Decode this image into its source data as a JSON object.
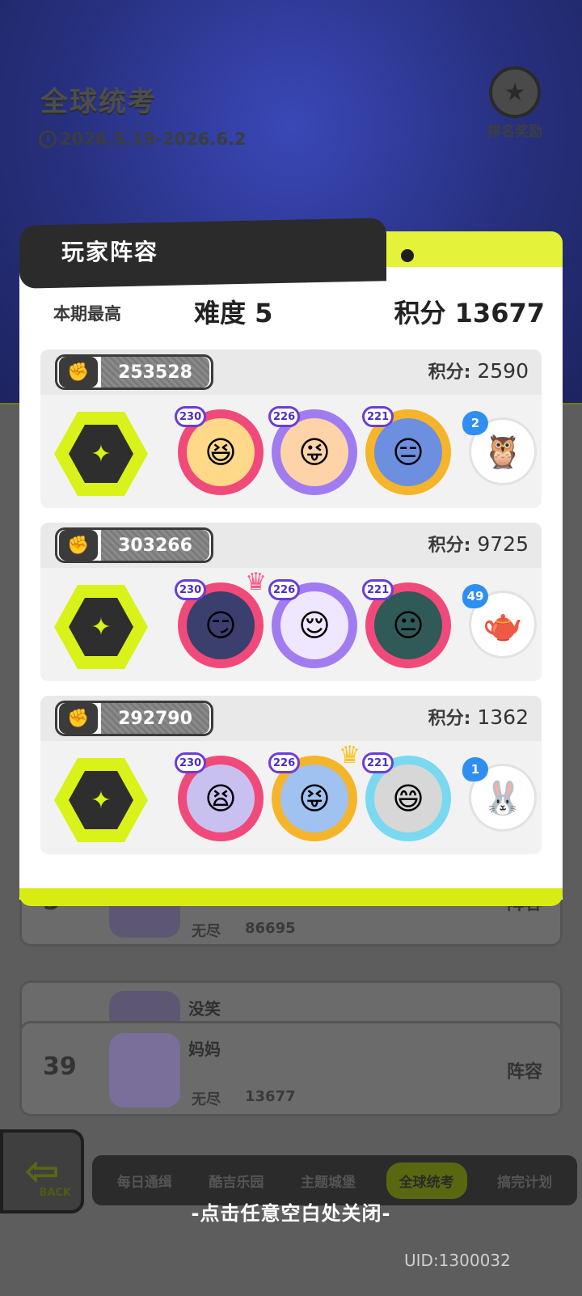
{
  "event": {
    "title": "全球统考",
    "date_range": "2026.5.19-2026.6.2",
    "reward_label": "排名奖励"
  },
  "modal": {
    "title": "玩家阵容",
    "summary_label": "本期最高",
    "difficulty": "难度 5",
    "score": "积分 13677",
    "points_key": "积分:",
    "teams": [
      {
        "id": "253528",
        "points": "2590",
        "heroes": [
          {
            "level": "230",
            "icon": "blonde-heroine-portrait",
            "frame": "#f04a7a",
            "face": "#ffd889",
            "glyph": "😆"
          },
          {
            "level": "226",
            "icon": "orange-hair-heroine-portrait",
            "frame": "#a07cf0",
            "face": "#ffd3a8",
            "glyph": "😜"
          },
          {
            "level": "221",
            "icon": "blue-hair-heroine-portrait",
            "frame": "#f5b52a",
            "face": "#6d8fe0",
            "glyph": "😑"
          }
        ],
        "pet": {
          "level": "2",
          "icon": "yellow-owl-pet",
          "glyph": "🦉"
        }
      },
      {
        "id": "303266",
        "points": "9725",
        "heroes": [
          {
            "level": "230",
            "icon": "dark-hair-heroine-portrait",
            "frame": "#f04a7a",
            "face": "#3a3f6e",
            "glyph": "😏",
            "crown": true,
            "crown_color": "#ff5a86"
          },
          {
            "level": "226",
            "icon": "lavender-sheep-heroine-portrait",
            "frame": "#a07cf0",
            "face": "#efe6ff",
            "glyph": "😌"
          },
          {
            "level": "221",
            "icon": "green-hair-heroine-portrait",
            "frame": "#f04a7a",
            "face": "#2f5a58",
            "glyph": "😐"
          }
        ],
        "pet": {
          "level": "49",
          "icon": "blue-teapot-pet",
          "glyph": "🫖"
        }
      },
      {
        "id": "292790",
        "points": "1362",
        "heroes": [
          {
            "level": "230",
            "icon": "silver-hair-heroine-portrait",
            "frame": "#f04a7a",
            "face": "#c8c1f0",
            "glyph": "😫"
          },
          {
            "level": "226",
            "icon": "blue-hair-crowned-heroine-portrait",
            "frame": "#f5b52a",
            "face": "#9fc2f0",
            "glyph": "😝",
            "crown": true,
            "crown_color": "#ffc21a"
          },
          {
            "level": "221",
            "icon": "gray-hair-heroine-portrait",
            "frame": "#7ad8f0",
            "face": "#d7d7d7",
            "glyph": "😄"
          }
        ],
        "pet": {
          "level": "1",
          "icon": "blue-bunny-pet",
          "glyph": "🐰"
        }
      }
    ]
  },
  "background_rows": [
    {
      "rank": "5",
      "name": "",
      "mode": "无尽",
      "score": "86695",
      "lineup": "阵容"
    },
    {
      "rank": "",
      "name": "没笑",
      "mode": "",
      "score": "",
      "lineup": ""
    },
    {
      "rank": "39",
      "name": "妈妈",
      "mode": "无尽",
      "score": "13677",
      "lineup": "阵容"
    }
  ],
  "nav": {
    "back_label": "BACK",
    "tabs": [
      "每日通缉",
      "酷吉乐园",
      "主题城堡",
      "全球统考",
      "搞完计划"
    ],
    "active_tab": "全球统考"
  },
  "close_hint": "-点击任意空白处关闭-",
  "uid": "UID:1300032",
  "colors": {
    "accent_lime": "#d9f21a",
    "modal_header": "#2b2b2b"
  }
}
